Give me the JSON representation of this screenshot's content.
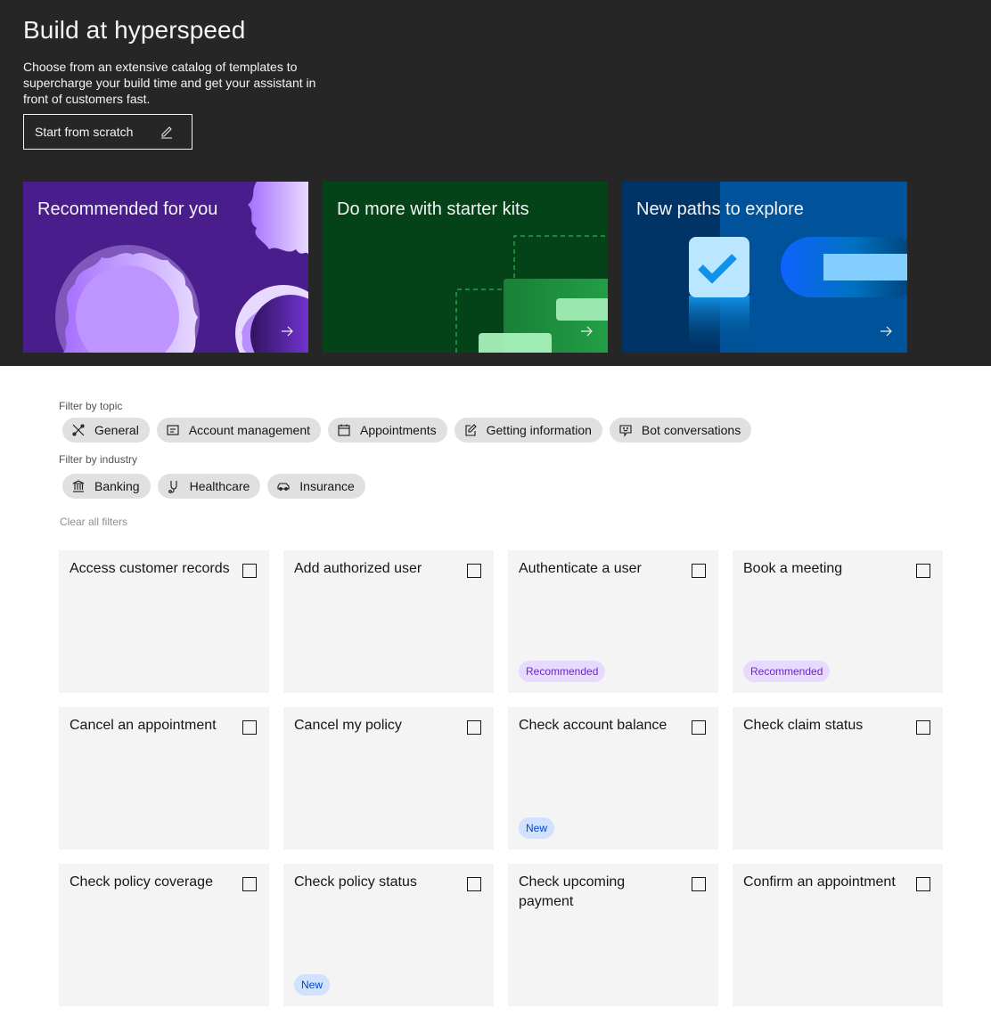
{
  "hero": {
    "title": "Build at hyperspeed",
    "description": "Choose from an extensive catalog of templates to supercharge your build time and get your assistant in front of customers fast.",
    "start_button": "Start from scratch",
    "tiles": [
      {
        "title": "Recommended for you",
        "color": "#491d8b"
      },
      {
        "title": "Do more with starter kits",
        "color": "#044317"
      },
      {
        "title": "New paths to explore",
        "color": "#003a6d"
      }
    ]
  },
  "filters": {
    "topic_label": "Filter by topic",
    "topics": [
      {
        "label": "General",
        "icon": "tools-icon"
      },
      {
        "label": "Account management",
        "icon": "account-card-icon"
      },
      {
        "label": "Appointments",
        "icon": "calendar-icon"
      },
      {
        "label": "Getting information",
        "icon": "edit-icon"
      },
      {
        "label": "Bot conversations",
        "icon": "chat-bot-icon"
      }
    ],
    "industry_label": "Filter by industry",
    "industries": [
      {
        "label": "Banking",
        "icon": "bank-icon"
      },
      {
        "label": "Healthcare",
        "icon": "stethoscope-icon"
      },
      {
        "label": "Insurance",
        "icon": "car-icon"
      }
    ],
    "clear_label": "Clear all filters"
  },
  "templates": [
    {
      "title": "Access customer records",
      "tag": ""
    },
    {
      "title": "Add authorized user",
      "tag": ""
    },
    {
      "title": "Authenticate a user",
      "tag": "Recommended"
    },
    {
      "title": "Book a meeting",
      "tag": "Recommended"
    },
    {
      "title": "Cancel an appointment",
      "tag": ""
    },
    {
      "title": "Cancel my policy",
      "tag": ""
    },
    {
      "title": "Check account balance",
      "tag": "New"
    },
    {
      "title": "Check claim status",
      "tag": ""
    },
    {
      "title": "Check policy coverage",
      "tag": ""
    },
    {
      "title": "Check policy status",
      "tag": "New"
    },
    {
      "title": "Check upcoming payment",
      "tag": ""
    },
    {
      "title": "Confirm an appointment",
      "tag": ""
    }
  ]
}
